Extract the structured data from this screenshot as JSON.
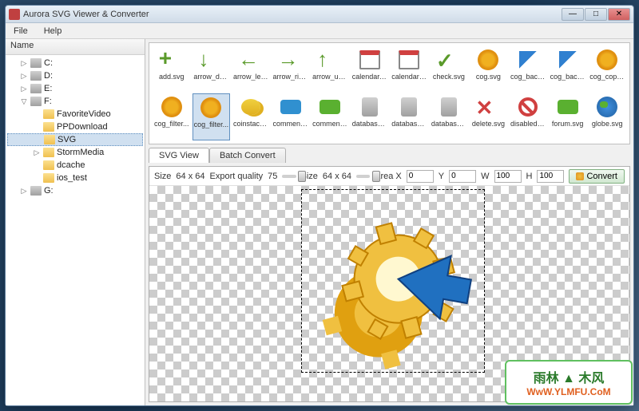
{
  "window": {
    "title": "Aurora SVG Viewer & Converter"
  },
  "menu": {
    "file": "File",
    "help": "Help"
  },
  "sidebar": {
    "header": "Name",
    "items": [
      {
        "toggle": "▷",
        "icon": "drive",
        "label": "C:"
      },
      {
        "toggle": "▷",
        "icon": "drive",
        "label": "D:"
      },
      {
        "toggle": "▷",
        "icon": "drive",
        "label": "E:"
      },
      {
        "toggle": "▽",
        "icon": "drive",
        "label": "F:"
      },
      {
        "toggle": "",
        "icon": "folder",
        "label": "FavoriteVideo",
        "indent": 2
      },
      {
        "toggle": "",
        "icon": "folder",
        "label": "PPDownload",
        "indent": 2
      },
      {
        "toggle": "",
        "icon": "folder",
        "label": "SVG",
        "indent": 2,
        "selected": true
      },
      {
        "toggle": "▷",
        "icon": "folder",
        "label": "StormMedia",
        "indent": 2
      },
      {
        "toggle": "",
        "icon": "folder",
        "label": "dcache",
        "indent": 2
      },
      {
        "toggle": "",
        "icon": "folder",
        "label": "ios_test",
        "indent": 2
      },
      {
        "toggle": "▷",
        "icon": "drive",
        "label": "G:"
      }
    ]
  },
  "grid": {
    "items": [
      {
        "label": "add.svg",
        "type": "plus"
      },
      {
        "label": "arrow_do...",
        "type": "down"
      },
      {
        "label": "arrow_left...",
        "type": "left"
      },
      {
        "label": "arrow_rig...",
        "type": "right"
      },
      {
        "label": "arrow_up...",
        "type": "up"
      },
      {
        "label": "calendar.s...",
        "type": "cal"
      },
      {
        "label": "calendar_...",
        "type": "cal"
      },
      {
        "label": "check.svg",
        "type": "check"
      },
      {
        "label": "cog.svg",
        "type": "cog"
      },
      {
        "label": "cog_back...",
        "type": "flag"
      },
      {
        "label": "cog_back...",
        "type": "flag"
      },
      {
        "label": "cog_copy...",
        "type": "cog"
      },
      {
        "label": "cog_filter...",
        "type": "cog"
      },
      {
        "label": "cog_filter...",
        "type": "cog",
        "selected": true
      },
      {
        "label": "coinstack...",
        "type": "coins"
      },
      {
        "label": "comment...",
        "type": "comment"
      },
      {
        "label": "comment...",
        "type": "comment-g"
      },
      {
        "label": "database...",
        "type": "db"
      },
      {
        "label": "database_...",
        "type": "db"
      },
      {
        "label": "database_...",
        "type": "db"
      },
      {
        "label": "delete.svg",
        "type": "x"
      },
      {
        "label": "disabled.s...",
        "type": "ban"
      },
      {
        "label": "forum.svg",
        "type": "comment-g"
      },
      {
        "label": "globe.svg",
        "type": "globe"
      }
    ]
  },
  "tabs": {
    "view": "SVG View",
    "batch": "Batch Convert"
  },
  "controls": {
    "size_label": "Size",
    "size_value": "64 x 64",
    "quality_label": "Export quality",
    "quality_value": "75",
    "size2_label": "Size",
    "size2_value": "64 x 64",
    "area_label": "Area X",
    "area_x": "0",
    "y_label": "Y",
    "area_y": "0",
    "w_label": "W",
    "area_w": "100",
    "h_label": "H",
    "area_h": "100",
    "convert": "Convert"
  },
  "watermark": {
    "line1": "雨林 ▲ 木风",
    "line2": "WwW.YLMFU.CoM"
  }
}
